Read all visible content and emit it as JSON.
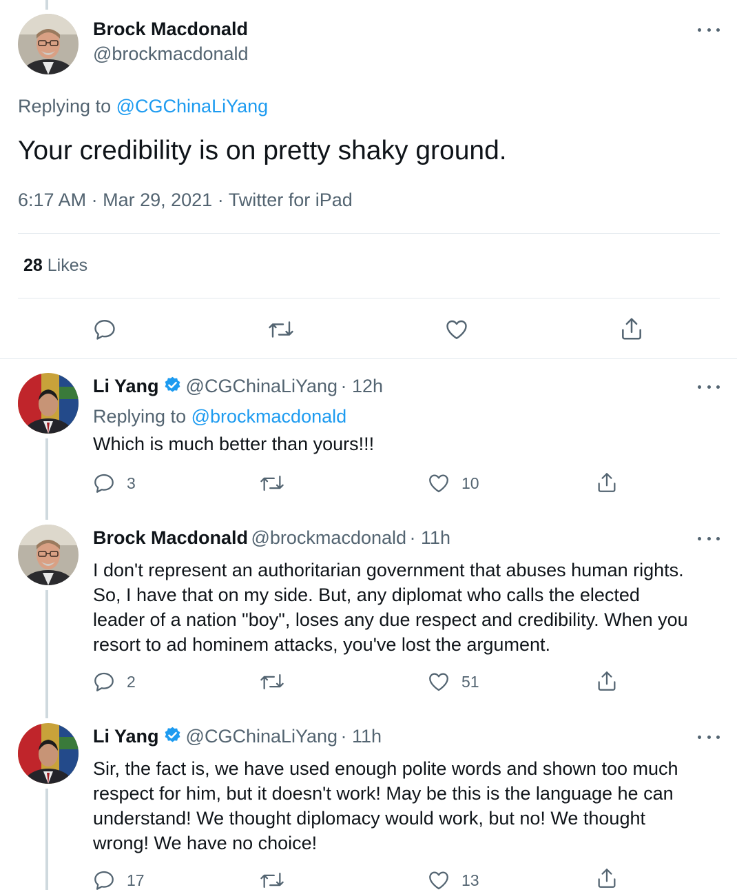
{
  "main_tweet": {
    "name": "Brock Macdonald",
    "handle": "@brockmacdonald",
    "replying_prefix": "Replying to",
    "replying_to": "@CGChinaLiYang",
    "text": "Your credibility is on pretty shaky ground.",
    "time": "6:17 AM",
    "date": "Mar 29, 2021",
    "source": "Twitter for iPad",
    "separator": "·",
    "likes_count": "28",
    "likes_label": "Likes"
  },
  "replies": [
    {
      "name": "Li Yang",
      "verified": true,
      "handle": "@CGChinaLiYang",
      "time": "· 12h",
      "replying_prefix": "Replying to",
      "replying_to": "@brockmacdonald",
      "text": "Which is much better than yours!!!",
      "reply_count": "3",
      "retweet_count": "",
      "like_count": "10"
    },
    {
      "name": "Brock Macdonald",
      "verified": false,
      "handle": "@brockmacdonald",
      "time": "· 11h",
      "text_lines": [
        "I don't represent an authoritarian government that abuses human rights.",
        "So, I have that on my side. But, any diplomat who calls the elected",
        "leader of a nation \"boy\", loses any due respect and credibility. When you",
        "resort to ad hominem attacks, you've lost the argument."
      ],
      "reply_count": "2",
      "retweet_count": "",
      "like_count": "51"
    },
    {
      "name": "Li Yang",
      "verified": true,
      "handle": "@CGChinaLiYang",
      "time": "· 11h",
      "text_lines": [
        "Sir, the fact is, we have used enough polite words and shown too much",
        "respect for him, but it doesn't work! May be this is the language he can",
        "understand! We thought diplomacy would work, but no! We thought",
        "wrong! We have no choice!"
      ],
      "reply_count": "17",
      "retweet_count": "",
      "like_count": "13"
    }
  ],
  "icons": [
    "reply-icon",
    "retweet-icon",
    "like-icon",
    "share-icon",
    "more-icon",
    "verified-icon"
  ],
  "colors": {
    "link": "#1d9bf0",
    "muted": "#536471",
    "text": "#0f1419",
    "divider": "#e1e8ed"
  }
}
